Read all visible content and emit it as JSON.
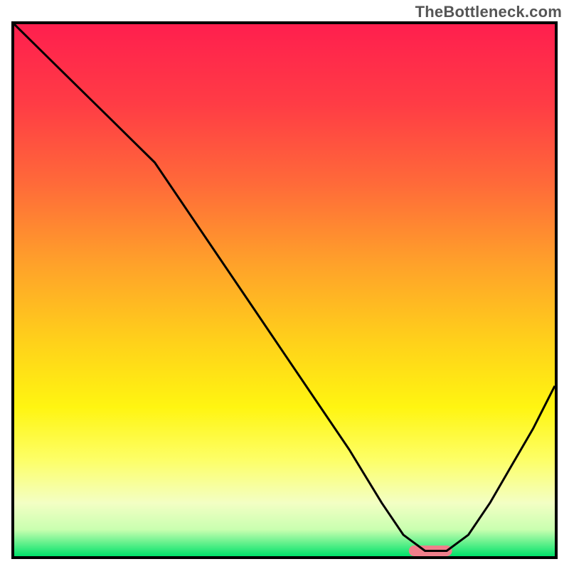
{
  "watermark": "TheBottleneck.com",
  "chart_data": {
    "type": "line",
    "title": "",
    "xlabel": "",
    "ylabel": "",
    "xlim": [
      0,
      100
    ],
    "ylim": [
      0,
      100
    ],
    "grid": false,
    "legend": false,
    "background_gradient_stops": [
      {
        "offset": 0.0,
        "color": "#ff1f4e"
      },
      {
        "offset": 0.15,
        "color": "#ff3c45"
      },
      {
        "offset": 0.3,
        "color": "#ff6a39"
      },
      {
        "offset": 0.45,
        "color": "#ffa12a"
      },
      {
        "offset": 0.6,
        "color": "#ffd21a"
      },
      {
        "offset": 0.72,
        "color": "#fff511"
      },
      {
        "offset": 0.82,
        "color": "#fdff68"
      },
      {
        "offset": 0.9,
        "color": "#f3ffc4"
      },
      {
        "offset": 0.95,
        "color": "#c9ffb0"
      },
      {
        "offset": 1.0,
        "color": "#00e26a"
      }
    ],
    "series": [
      {
        "name": "bottleneck-curve",
        "color": "#000000",
        "x": [
          0,
          6,
          12,
          18,
          22,
          26,
          32,
          38,
          44,
          50,
          56,
          62,
          68,
          72,
          76,
          80,
          84,
          88,
          92,
          96,
          100
        ],
        "y": [
          100,
          94,
          88,
          82,
          78,
          74,
          65,
          56,
          47,
          38,
          29,
          20,
          10,
          4,
          1,
          1,
          4,
          10,
          17,
          24,
          32
        ]
      }
    ],
    "marker": {
      "name": "optimal-region",
      "color": "#ef7f8b",
      "x_center": 77,
      "y_center": 1.0,
      "width_x": 8,
      "height_y": 2.0
    }
  }
}
